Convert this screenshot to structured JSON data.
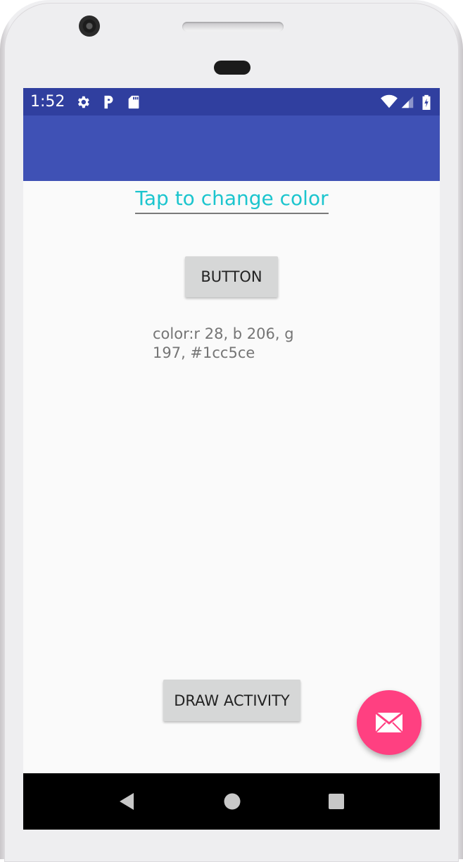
{
  "status_bar": {
    "time": "1:52",
    "left_icons": [
      "gear-icon",
      "parking-icon",
      "sd-card-icon"
    ],
    "right_icons": [
      "wifi-icon",
      "signal-icon",
      "battery-charging-icon"
    ],
    "color": "#303f9f"
  },
  "app_bar": {
    "color": "#3f51b5"
  },
  "main": {
    "edit_text": "Tap to change color",
    "edit_text_color": "#1cc5ce",
    "button_label": "BUTTON",
    "color_info": "color:r 28, b 206, g 197, #1cc5ce",
    "draw_button_label": "DRAW ACTIVITY"
  },
  "fab": {
    "icon": "mail-icon",
    "color": "#ff4081"
  },
  "nav_bar": {
    "icons": [
      "back-icon",
      "home-icon",
      "recents-icon"
    ]
  }
}
